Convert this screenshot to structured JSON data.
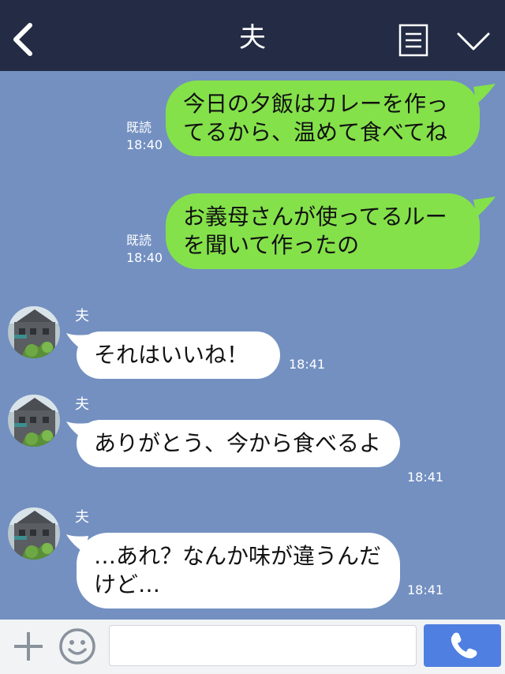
{
  "header": {
    "title": "夫",
    "back_icon": "chevron-left-icon",
    "menu_icon": "list-menu-icon",
    "collapse_icon": "chevron-down-icon",
    "background": "#232c44"
  },
  "chat": {
    "background": "#7390c1",
    "messages": [
      {
        "direction": "out",
        "text": "今日の夕飯はカレーを作ってるから、温めて食べてね",
        "status": "既読",
        "time": "18:40"
      },
      {
        "direction": "out",
        "text": "お義母さんが使ってるルーを聞いて作ったの",
        "status": "既読",
        "time": "18:40"
      },
      {
        "direction": "in",
        "sender": "夫",
        "text": "それはいいね！",
        "time": "18:41"
      },
      {
        "direction": "in",
        "sender": "夫",
        "text": "ありがとう、今から食べるよ",
        "time": "18:41"
      },
      {
        "direction": "in",
        "sender": "夫",
        "text": "…あれ？なんか味が違うんだけど…",
        "time": "18:41"
      }
    ],
    "outgoing_color": "#84e14a",
    "incoming_color": "#ffffff"
  },
  "footer": {
    "plus_icon": "plus-icon",
    "emoji_icon": "smiley-icon",
    "input_placeholder": "",
    "call_icon": "phone-icon",
    "call_button_color": "#4f7fe0"
  }
}
